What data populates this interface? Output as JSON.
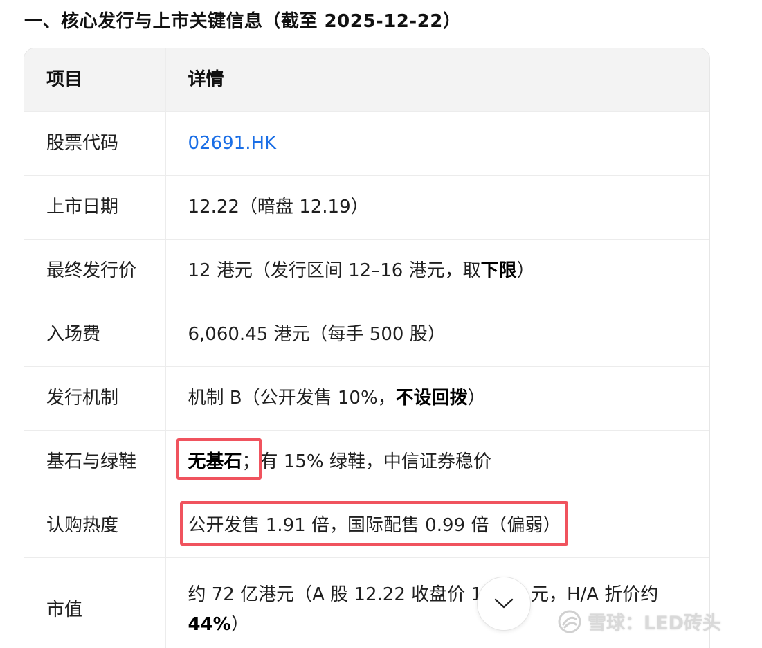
{
  "heading": "一、核心发行与上市关键信息（截至 2025-12-22）",
  "table": {
    "headers": [
      "项目",
      "详情"
    ],
    "rows": [
      {
        "label": "股票代码",
        "value": "02691.HK"
      },
      {
        "label": "上市日期",
        "value": "12.22（暗盘 12.19）"
      },
      {
        "label": "最终发行价",
        "value_pre": "12 港元（发行区间 12–16 港元，取",
        "value_bold": "下限",
        "value_post": "）"
      },
      {
        "label": "入场费",
        "value": "6,060.45 港元（每手 500 股）"
      },
      {
        "label": "发行机制",
        "value_pre": "机制 B（公开发售 10%，",
        "value_bold": "不设回拨",
        "value_post": "）"
      },
      {
        "label": "基石与绿鞋",
        "value_bold": "无基石",
        "value_post": "；有 15% 绿鞋，中信证券稳价"
      },
      {
        "label": "认购热度",
        "value": "公开发售 1.91 倍，国际配售 0.99 倍（偏弱）"
      },
      {
        "label": "市值",
        "value_line1": "约 72 亿港元（A 股 12.22 收盘价 1",
        "value_line1_after": "元，H/A 折价约",
        "value_bold": "44%",
        "value_post": "）"
      }
    ]
  },
  "scroll_button": {
    "icon": "chevron-down-icon"
  },
  "watermark": {
    "text": "雪球：LED砖头",
    "icon": "xueqiu-logo-icon"
  },
  "colors": {
    "link": "#1a6ee6",
    "highlight_box": "#f0535e",
    "header_bg": "#f3f3f3"
  }
}
